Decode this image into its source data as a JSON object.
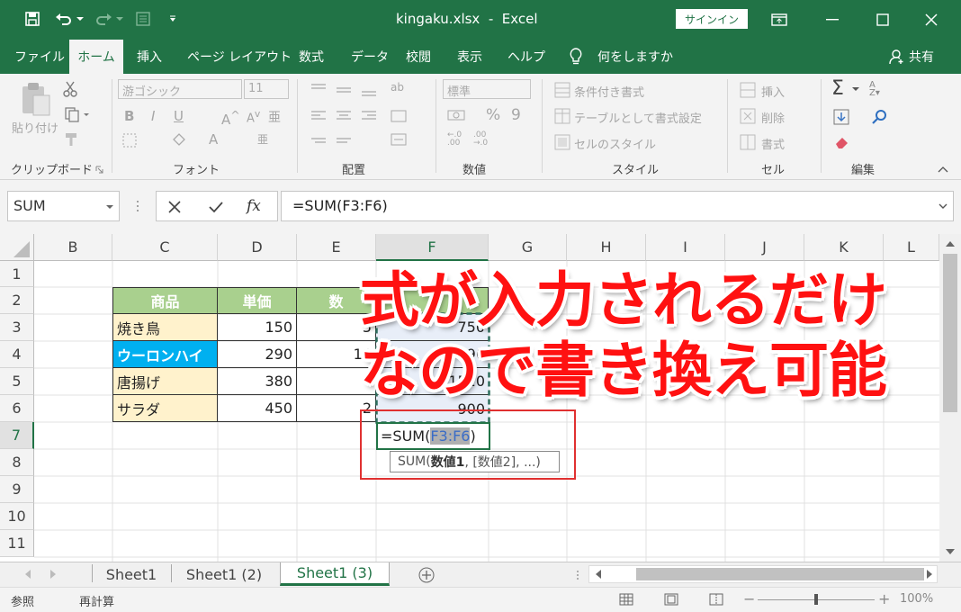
{
  "window": {
    "title": "kingaku.xlsx  -  Excel",
    "signin_label": "サインイン"
  },
  "tabs": [
    "ファイル",
    "ホーム",
    "挿入",
    "ページ レイアウト",
    "数式",
    "データ",
    "校閲",
    "表示",
    "ヘルプ"
  ],
  "tell_me": "何をしますか",
  "share": "共有",
  "ribbon": {
    "clipboard": {
      "label": "クリップボード",
      "paste": "貼り付け"
    },
    "font": {
      "label": "フォント",
      "font_name": "游ゴシック",
      "font_size": "11"
    },
    "alignment": {
      "label": "配置"
    },
    "number": {
      "label": "数値",
      "format": "標準"
    },
    "styles": {
      "label": "スタイル",
      "conditional": "条件付き書式",
      "table": "テーブルとして書式設定",
      "cell_styles": "セルのスタイル"
    },
    "cells": {
      "label": "セル",
      "insert": "挿入",
      "delete": "削除",
      "format": "書式"
    },
    "editing": {
      "label": "編集"
    }
  },
  "formula_bar": {
    "name_box": "SUM",
    "formula": "=SUM(F3:F6)"
  },
  "columns": [
    "B",
    "C",
    "D",
    "E",
    "F",
    "G",
    "H",
    "I",
    "J",
    "K",
    "L"
  ],
  "rows": [
    "1",
    "2",
    "3",
    "4",
    "5",
    "6",
    "7",
    "8",
    "9",
    "10",
    "11"
  ],
  "table": {
    "headers": [
      "商品",
      "単価",
      "数"
    ],
    "items": [
      {
        "name": "焼き鳥",
        "price": "150",
        "qty": "5",
        "amount": "750"
      },
      {
        "name": "ウーロンハイ",
        "price": "290",
        "qty": "10",
        "amount": "90"
      },
      {
        "name": "唐揚げ",
        "price": "380",
        "qty": "4",
        "amount": "1520"
      },
      {
        "name": "サラダ",
        "price": "450",
        "qty": "2",
        "amount": "900"
      }
    ]
  },
  "editing_cell": {
    "prefix": "=SUM(",
    "ref": "F3:F6",
    "suffix": ")"
  },
  "tooltip": {
    "func": "SUM(",
    "arg1": "数値1",
    "rest": ", [数値2], ...)"
  },
  "overlay": {
    "line1": "式が入力されるだけ",
    "line2": "なので書き換え可能"
  },
  "sheets": [
    "Sheet1",
    "Sheet1 (2)",
    "Sheet1 (3)"
  ],
  "status": {
    "mode": "参照",
    "recalc": "再計算",
    "zoom": "100%"
  },
  "colors": {
    "excel_green": "#217346",
    "header_fill": "#a9d08e",
    "item_fill": "#fff2cc",
    "selected_fill": "#00b0f0",
    "overlay_text": "#ff1111"
  }
}
